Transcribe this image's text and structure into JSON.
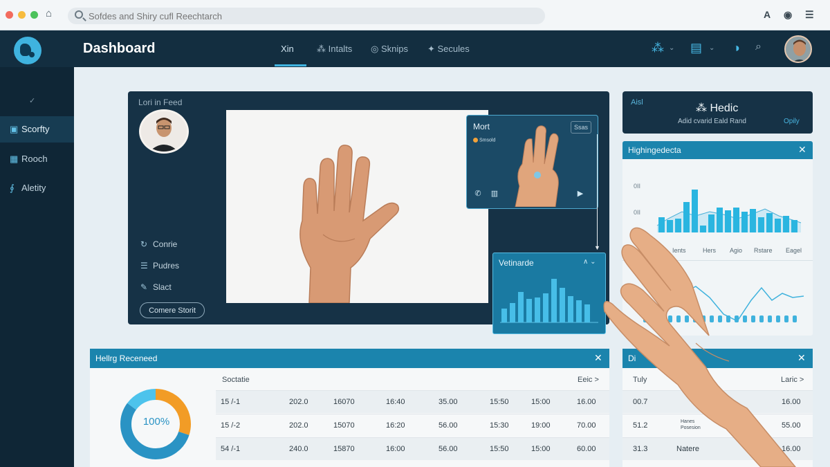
{
  "browser": {
    "url_placeholder": "Sofdes and Shiry cufl Reechtarch",
    "icons": [
      "home-icon",
      "search-icon",
      "account-icon",
      "extension-icon",
      "menu-icon"
    ]
  },
  "topnav": {
    "title": "Dashboard",
    "tabs": [
      "Xin",
      "Intalts",
      "Sknips",
      "Secules"
    ],
    "icons": [
      "network-icon",
      "list-icon",
      "theme-icon",
      "search-icon"
    ]
  },
  "sidebar": {
    "items": [
      {
        "label": "Scorfty",
        "icon": "folder-icon",
        "active": true
      },
      {
        "label": "Rooch",
        "icon": "board-icon",
        "active": false
      },
      {
        "label": "Aletity",
        "icon": "activity-icon",
        "active": false
      }
    ]
  },
  "main_panel": {
    "feed_label": "Lori in Feed",
    "menu": [
      {
        "label": "Conrie",
        "icon": "refresh-icon"
      },
      {
        "label": "Pudres",
        "icon": "list-icon"
      },
      {
        "label": "Slact",
        "icon": "tools-icon"
      }
    ],
    "camera_button": "Comere Storit"
  },
  "popup": {
    "title": "Mort",
    "badge": "Ssas",
    "tag": "Smsold"
  },
  "small_chart": {
    "title": "Vetinarde",
    "controls": "∧ ⌄"
  },
  "right_top": {
    "left": "Aisl",
    "title": "Hedic",
    "subtitle": "Adid cvarid Eald Rand",
    "right": "Opily"
  },
  "right_chart": {
    "title": "Highingedecta",
    "y_labels": [
      "0II",
      "0II"
    ],
    "x_labels": [
      "Ients",
      "Hers",
      "Agio",
      "Rstare",
      "Eagel"
    ]
  },
  "bottom_left": {
    "title": "Hellrg Receneed",
    "donut_label": "100%",
    "donut_segments": [
      {
        "color": "#f29c26",
        "fraction": 0.3
      },
      {
        "color": "#2a93c4",
        "fraction": 0.55
      },
      {
        "color": "#4dc3ec",
        "fraction": 0.15
      }
    ],
    "header_left": "Soctatie",
    "header_right": "Eeic >",
    "rows": [
      [
        "15 /-1",
        "202.0",
        "16070",
        "16:40",
        "35.00",
        "15:50",
        "15:00",
        "16.00"
      ],
      [
        "15 /-2",
        "202.0",
        "15070",
        "16:20",
        "56.00",
        "15:30",
        "19:00",
        "70.00"
      ],
      [
        "54 /-1",
        "240.0",
        "15870",
        "16:00",
        "56.00",
        "15:50",
        "15:00",
        "60.00"
      ]
    ]
  },
  "bottom_right": {
    "title": "Di",
    "header_left": "Tuly",
    "header_right": "Laric >",
    "rows": [
      {
        "a": "00.7",
        "note": "",
        "b": "16.00"
      },
      {
        "a": "51.2",
        "note": "Hanes Posesion",
        "b": "55.00"
      },
      {
        "a": "31.3",
        "note": "Natere",
        "b": "16.00"
      }
    ]
  }
}
